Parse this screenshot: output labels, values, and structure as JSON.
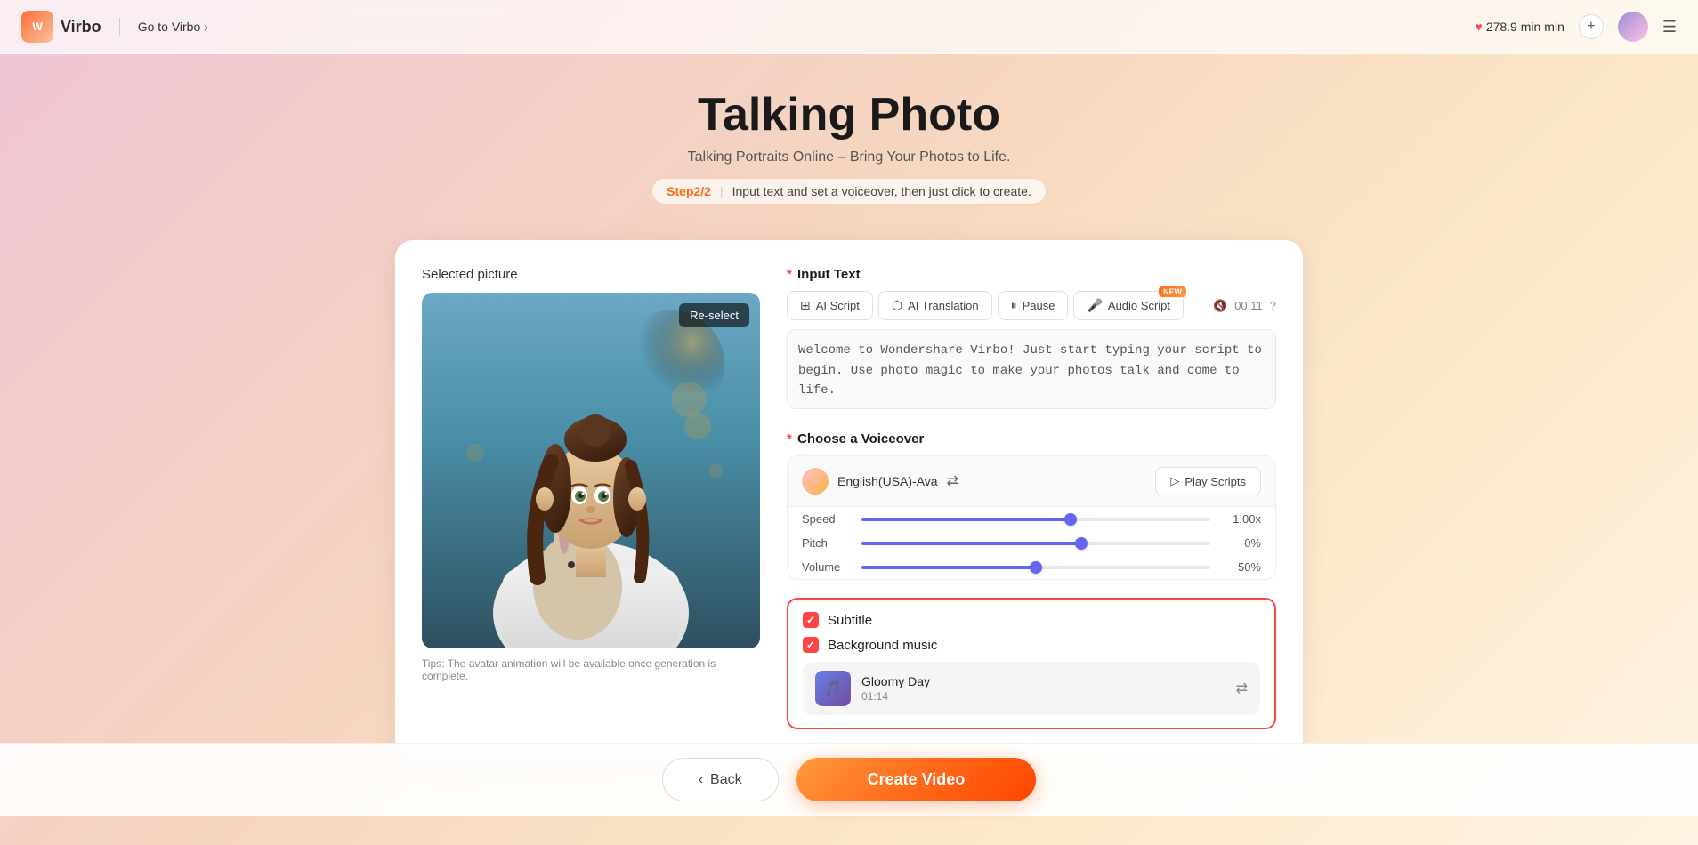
{
  "app": {
    "logo_text": "Virbo",
    "go_to_virbo": "Go to Virbo",
    "credits": "278.9 min",
    "page_title": "Talking Photo",
    "page_subtitle": "Talking Portraits Online – Bring Your Photos to Life.",
    "step_badge": "Step2/2",
    "step_pipe": "|",
    "step_desc": "Input text and set a voiceover, then just click to create."
  },
  "left_panel": {
    "selected_picture_label": "Selected picture",
    "reselect_label": "Re-select",
    "tip_text": "Tips: The avatar animation will be available once generation is complete."
  },
  "input_text": {
    "section_label": "Input Text",
    "tabs": [
      {
        "id": "ai_script",
        "label": "AI Script",
        "icon": "⊞"
      },
      {
        "id": "ai_translation",
        "label": "AI Translation",
        "icon": "⬡"
      },
      {
        "id": "pause",
        "label": "Pause",
        "icon": "⏸"
      },
      {
        "id": "audio_script",
        "label": "Audio Script",
        "icon": "🎤",
        "badge": "NEW"
      }
    ],
    "timer": "00:11",
    "placeholder": "Welcome to Wondershare Virbo! Just start typing your script to begin. Use photo magic to make your photos talk and come to life.",
    "script_content": "Welcome to Wondershare Virbo! Just start typing your script to begin. Use photo magic to make your photos talk and come to life."
  },
  "voiceover": {
    "section_label": "Choose a Voiceover",
    "voice_name": "English(USA)-Ava",
    "play_scripts_label": "Play Scripts",
    "sliders": [
      {
        "label": "Speed",
        "value": "1.00x",
        "fill_pct": 60
      },
      {
        "label": "Pitch",
        "value": "0%",
        "fill_pct": 63
      },
      {
        "label": "Volume",
        "value": "50%",
        "fill_pct": 50
      }
    ]
  },
  "extras": {
    "subtitle_label": "Subtitle",
    "bg_music_label": "Background music",
    "music_title": "Gloomy Day",
    "music_duration": "01:14"
  },
  "footer": {
    "back_label": "Back",
    "create_label": "Create Video"
  }
}
